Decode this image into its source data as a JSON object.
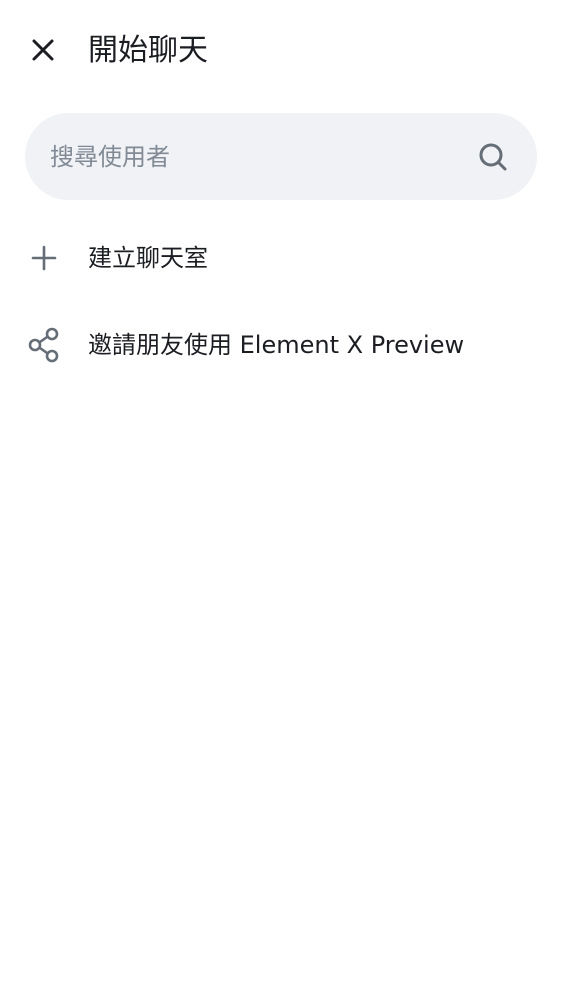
{
  "header": {
    "title": "開始聊天",
    "close_icon": "close-icon"
  },
  "search": {
    "placeholder": "搜尋使用者",
    "value": "",
    "icon": "search-icon"
  },
  "actions": [
    {
      "label": "建立聊天室",
      "icon": "plus-icon"
    },
    {
      "label": "邀請朋友使用 Element X Preview",
      "icon": "share-icon"
    }
  ],
  "colors": {
    "background": "#ffffff",
    "text_primary": "#1b1d22",
    "text_secondary": "#818a95",
    "search_background": "#f0f2f5",
    "icon": "#656d77"
  }
}
